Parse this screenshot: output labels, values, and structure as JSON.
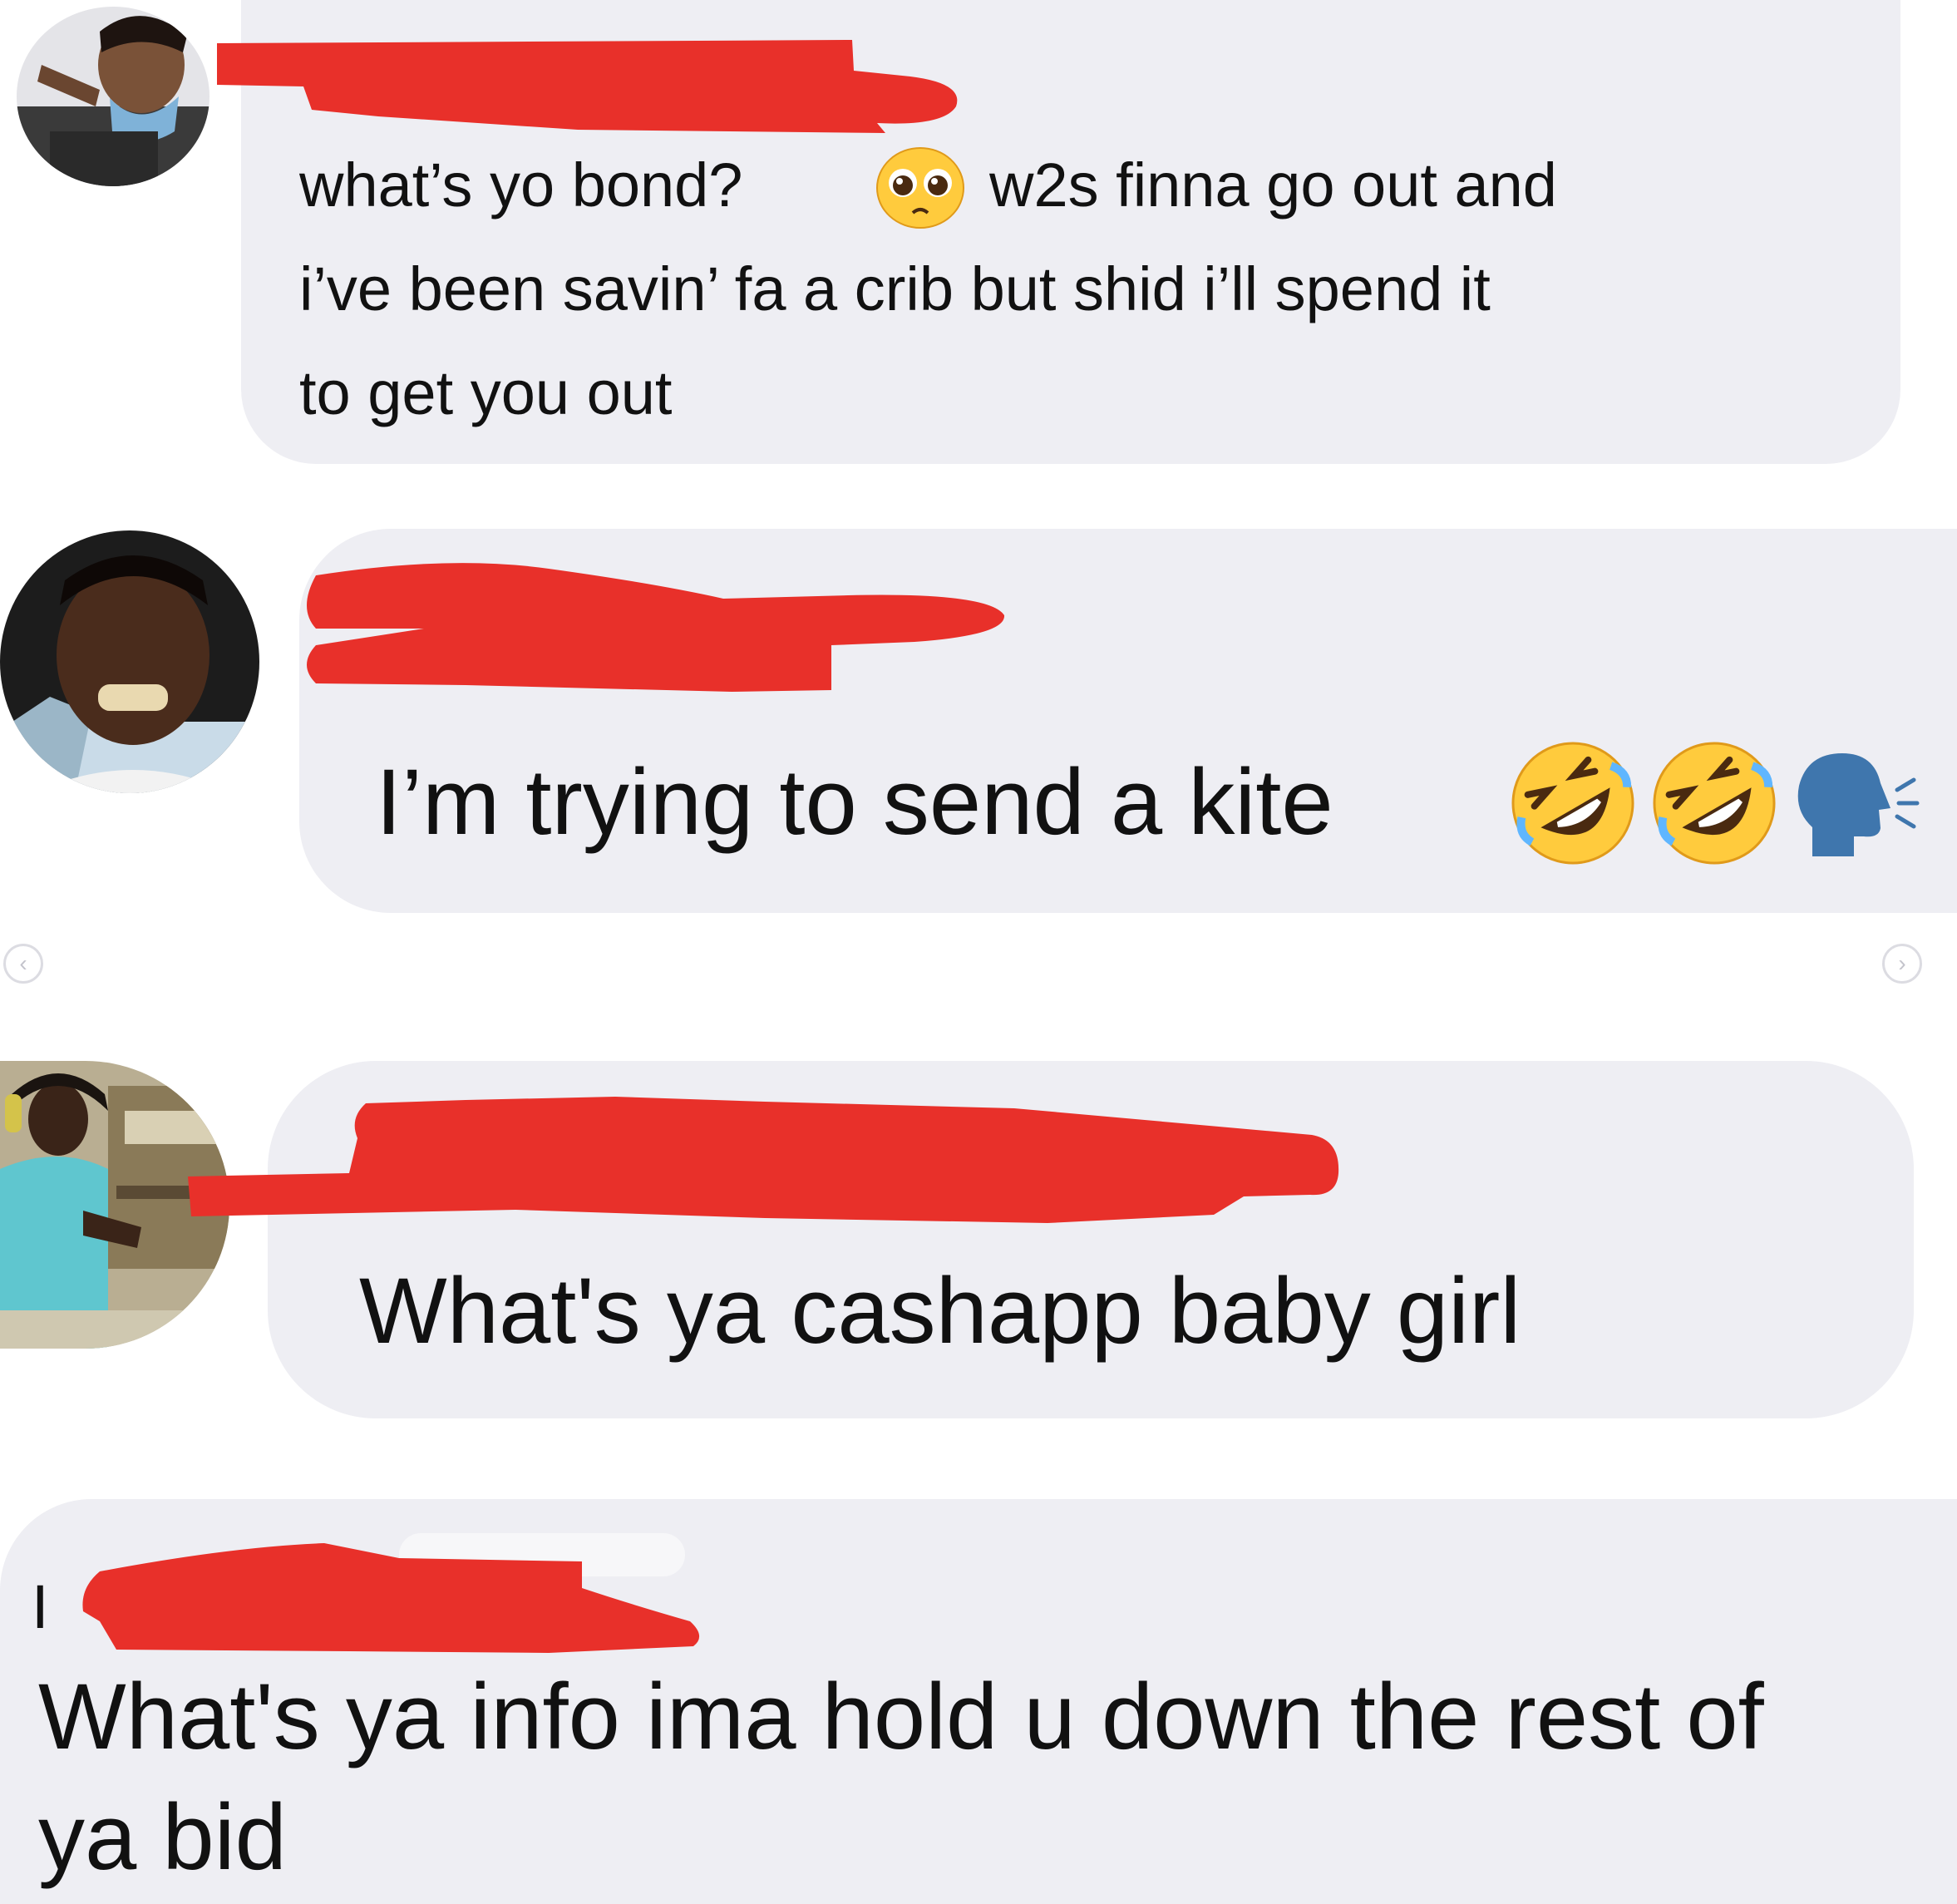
{
  "messages": [
    {
      "lines": [
        "what’s yo bond?",
        "w2s finna go out and",
        "i’ve been savin’ fa a crib but shid i’ll spend it",
        "to get you out"
      ],
      "emoji": [
        "pleading-face"
      ]
    },
    {
      "text": "I’m trying to send a kite",
      "emoji": [
        "rolling-on-floor-laughing",
        "rolling-on-floor-laughing",
        "speaking-head"
      ]
    },
    {
      "text": "What's ya cashapp baby girl"
    },
    {
      "lines": [
        "What's ya info ima hold u down the rest of",
        "ya bid"
      ],
      "partial_name_glyph": "I"
    }
  ],
  "carousel": {
    "prev_glyph": "‹",
    "next_glyph": "›"
  },
  "colors": {
    "bubble": "#eeeef3",
    "redaction": "#e8302a",
    "text": "#111111"
  }
}
